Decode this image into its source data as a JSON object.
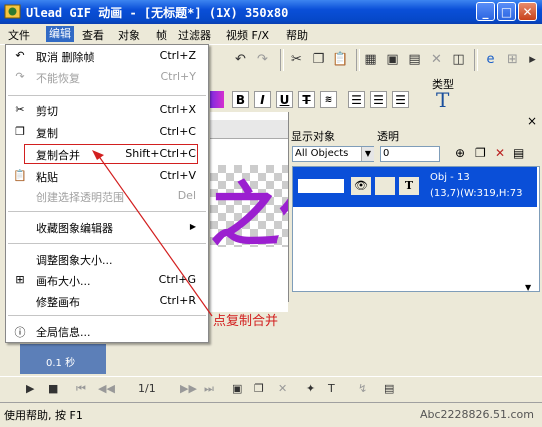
{
  "window": {
    "title": "Ulead GIF 动画 - [无标题*] (1X) 350x80"
  },
  "menubar": [
    "文件",
    "编辑",
    "查看",
    "对象",
    "帧",
    "过滤器",
    "视频 F/X",
    "帮助"
  ],
  "edit_menu": {
    "items": [
      {
        "label": "取消 删除帧",
        "shortcut": "Ctrl+Z",
        "icon": "undo-icon",
        "disabled": false
      },
      {
        "label": "不能恢复",
        "shortcut": "Ctrl+Y",
        "icon": "redo-icon",
        "disabled": true
      },
      {
        "label": "剪切",
        "shortcut": "Ctrl+X",
        "icon": "scissors-icon",
        "disabled": false
      },
      {
        "label": "复制",
        "shortcut": "Ctrl+C",
        "icon": "copy-icon",
        "disabled": false
      },
      {
        "label": "复制合并",
        "shortcut": "Shift+Ctrl+C",
        "icon": "",
        "disabled": false
      },
      {
        "label": "粘贴",
        "shortcut": "Ctrl+V",
        "icon": "paste-icon",
        "disabled": false
      },
      {
        "label": "创建选择透明范围",
        "shortcut": "Del",
        "icon": "",
        "disabled": true
      },
      {
        "label": "收藏图象编辑器",
        "shortcut": "",
        "icon": "",
        "disabled": false
      },
      {
        "label": "调整图象大小...",
        "shortcut": "",
        "icon": "",
        "disabled": false
      },
      {
        "label": "画布大小...",
        "shortcut": "Ctrl+G",
        "icon": "canvas-icon",
        "disabled": false
      },
      {
        "label": "修整画布",
        "shortcut": "Ctrl+R",
        "icon": "",
        "disabled": false
      },
      {
        "label": "全局信息...",
        "shortcut": "",
        "icon": "info-icon",
        "disabled": false
      }
    ]
  },
  "annotation": {
    "text": "点复制合并"
  },
  "format_bar": {
    "type_label": "类型",
    "bold": "B",
    "italic": "I",
    "underline": "U",
    "strike": "T"
  },
  "object_panel": {
    "show_label": "显示对象",
    "opacity_label": "透明",
    "show_value": "All Objects",
    "opacity_value": "0",
    "row": {
      "thumb": "",
      "name": "Obj - 13",
      "info": "(13,7)(W:319,H:73"
    }
  },
  "canvas": {
    "text": "之你"
  },
  "frames": {
    "delay": "0.1 秒"
  },
  "playbar": {
    "frame_counter": "1/1"
  },
  "status": {
    "text": "使用帮助, 按 F1"
  },
  "watermark": {
    "text": "Abc2228826.51.com"
  }
}
